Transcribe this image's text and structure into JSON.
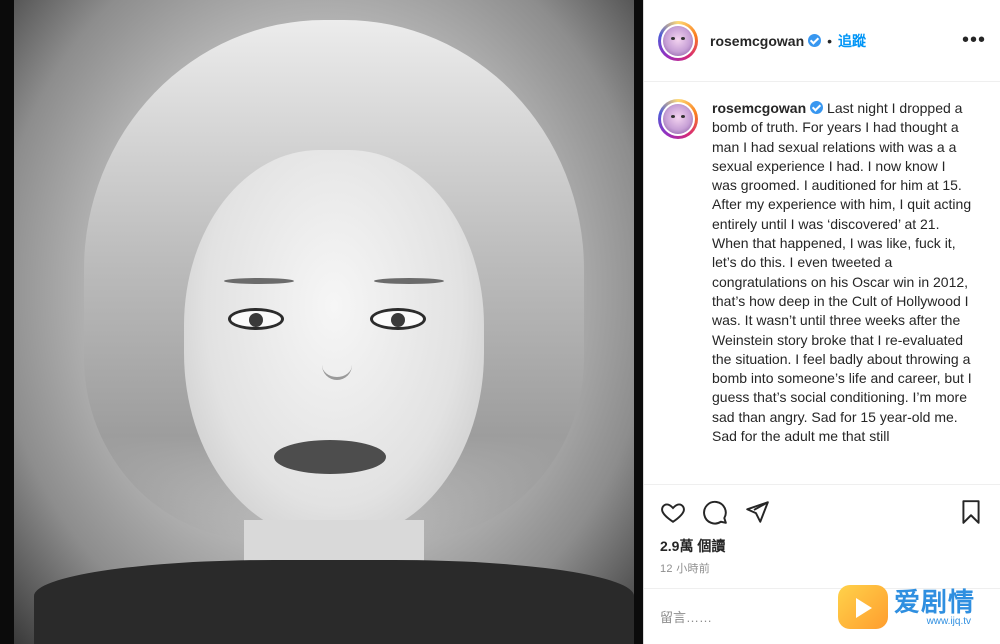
{
  "post": {
    "username": "rosemcgowan",
    "follow_label": "追蹤",
    "separator": "•",
    "more_label": "•••",
    "caption": "Last night I dropped a bomb of truth. For years I had thought a man I had sexual relations with was a a sexual experience I had. I now know I was groomed. I auditioned for him at 15. After my experience with him, I quit acting entirely until I was ‘discovered’ at 21. When that happened, I was like, fuck it, let’s do this. I even tweeted a congratulations on his Oscar win in 2012, that’s how deep in the Cult of Hollywood I was. It wasn’t until three weeks after the Weinstein story broke that I re-evaluated the situation. I feel badly about throwing a bomb into someone’s life and career, but I guess that’s social conditioning. I’m more sad than angry. Sad for 15 year-old me. Sad for the adult me that still",
    "views": "2.9萬 個讀",
    "time_ago": "12 小時前",
    "comment_placeholder": "留言……"
  },
  "icons": {
    "avatar": "avatar-icon",
    "verified": "verified-badge-icon",
    "like": "heart-icon",
    "comment": "comment-icon",
    "share": "send-icon",
    "save": "bookmark-icon"
  },
  "watermark": {
    "title": "爱剧情",
    "site": "www.ijq.tv"
  },
  "colors": {
    "link": "#0095f6",
    "verified": "#3897f0",
    "text": "#262626",
    "muted": "#8e8e8e"
  }
}
